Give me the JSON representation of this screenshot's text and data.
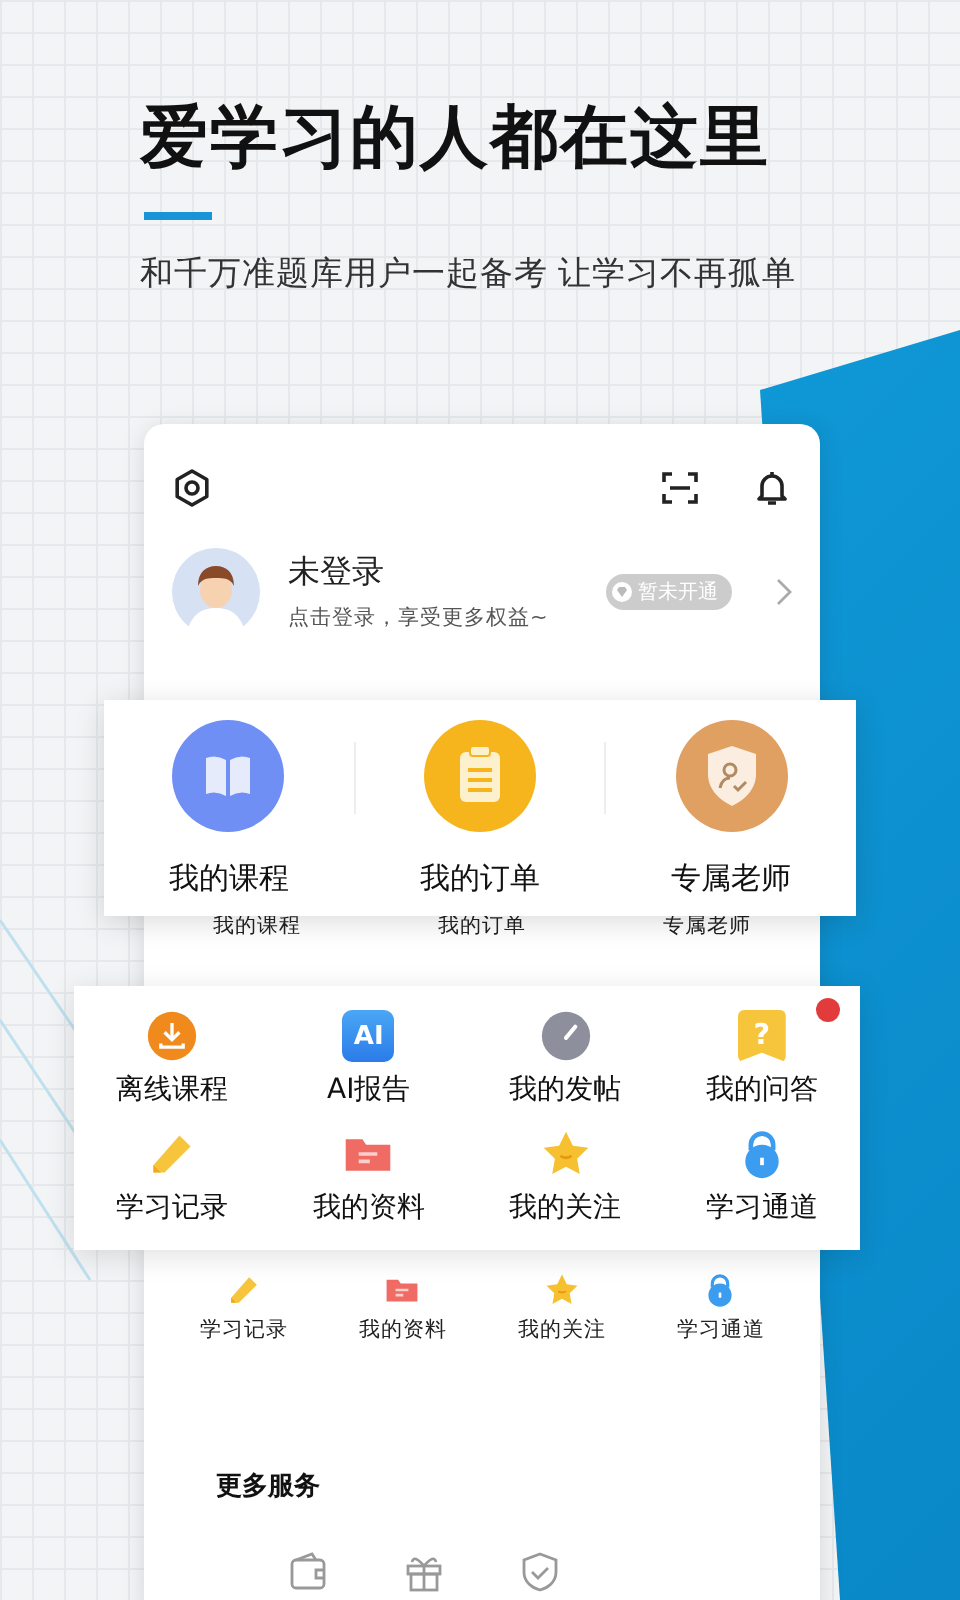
{
  "headline": "爱学习的人都在这里",
  "subtitle": "和千万准题库用户一起备考 让学习不再孤单",
  "profile": {
    "name": "未登录",
    "hint": "点击登录，享受更多权益~",
    "badge": "暂未开通"
  },
  "featured": [
    {
      "label": "我的课程",
      "color": "#6f8ff5"
    },
    {
      "label": "我的订单",
      "color": "#f6b51c"
    },
    {
      "label": "专属老师",
      "color": "#e0a062"
    }
  ],
  "featured_behind": [
    "我的课程",
    "我的订单",
    "专属老师"
  ],
  "tools": [
    {
      "label": "离线课程",
      "dot": false
    },
    {
      "label": "AI报告",
      "icon_text": "AI",
      "dot": false
    },
    {
      "label": "我的发帖",
      "dot": false
    },
    {
      "label": "我的问答",
      "icon_text": "?",
      "dot": true
    },
    {
      "label": "学习记录",
      "dot": false
    },
    {
      "label": "我的资料",
      "dot": false
    },
    {
      "label": "我的关注",
      "dot": false
    },
    {
      "label": "学习通道",
      "dot": false
    }
  ],
  "tools_behind": [
    "学习记录",
    "我的资料",
    "我的关注",
    "学习通道"
  ],
  "more_services": {
    "title": "更多服务"
  }
}
